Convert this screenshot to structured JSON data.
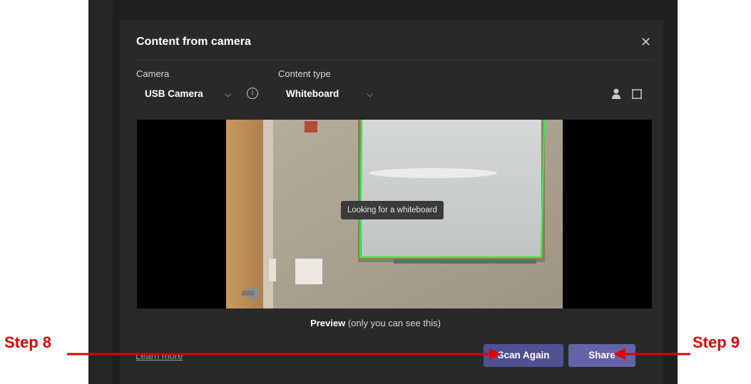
{
  "dialog": {
    "title": "Content from camera",
    "close_glyph": "✕"
  },
  "camera": {
    "label": "Camera",
    "value": "USB Camera"
  },
  "content_type": {
    "label": "Content type",
    "value": "Whiteboard"
  },
  "icons": {
    "chevron": "⌵",
    "info": "i",
    "person": "person-icon",
    "crop": "crop-icon"
  },
  "preview": {
    "tooltip": "Looking for a whiteboard",
    "caption_bold": "Preview",
    "caption_rest": " (only you can see this)"
  },
  "footer": {
    "learn_more": "Learn more",
    "scan_again": "Scan Again",
    "share": "Share"
  },
  "annotations": {
    "step8": "Step 8",
    "step9": "Step 9",
    "arrow_color": "#e00000"
  },
  "colors": {
    "accent": "#6264a7",
    "detect_outline": "#39e84a"
  }
}
